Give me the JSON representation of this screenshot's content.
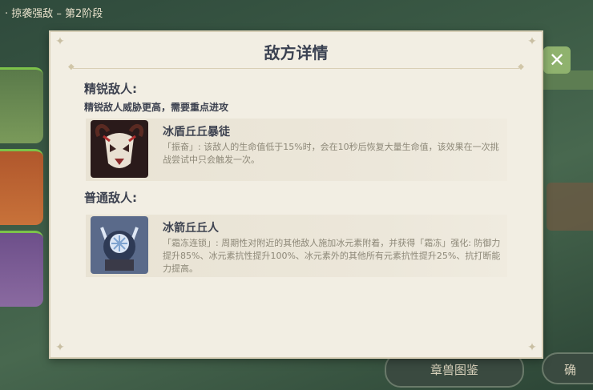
{
  "background": {
    "breadcrumb": "· 掠袭强敌 – 第2阶段",
    "close_glyph": "✕",
    "bottom_buttons": [
      "章兽图鉴",
      "确"
    ]
  },
  "dialog": {
    "title": "敌方详情",
    "elite": {
      "heading": "精锐敌人:",
      "description": "精锐敌人威胁更高，需要重点进攻",
      "enemy": {
        "name": "冰盾丘丘暴徒",
        "icon": "hilichurl-mask-portrait",
        "description": "「振奋」: 该敌人的生命值低于15%时，会在10秒后恢复大量生命值，该效果在一次挑战尝试中只会触发一次。"
      }
    },
    "normal": {
      "heading": "普通敌人:",
      "enemy": {
        "name": "冰箭丘丘人",
        "icon": "cryo-hilichurl-portrait",
        "description": "「霜冻连锁」: 周期性对附近的其他敌人施加冰元素附着，并获得「霜冻」强化: 防御力提升85%、冰元素抗性提升100%、冰元素外的其他所有元素抗性提升25%、抗打断能力提高。"
      }
    }
  }
}
